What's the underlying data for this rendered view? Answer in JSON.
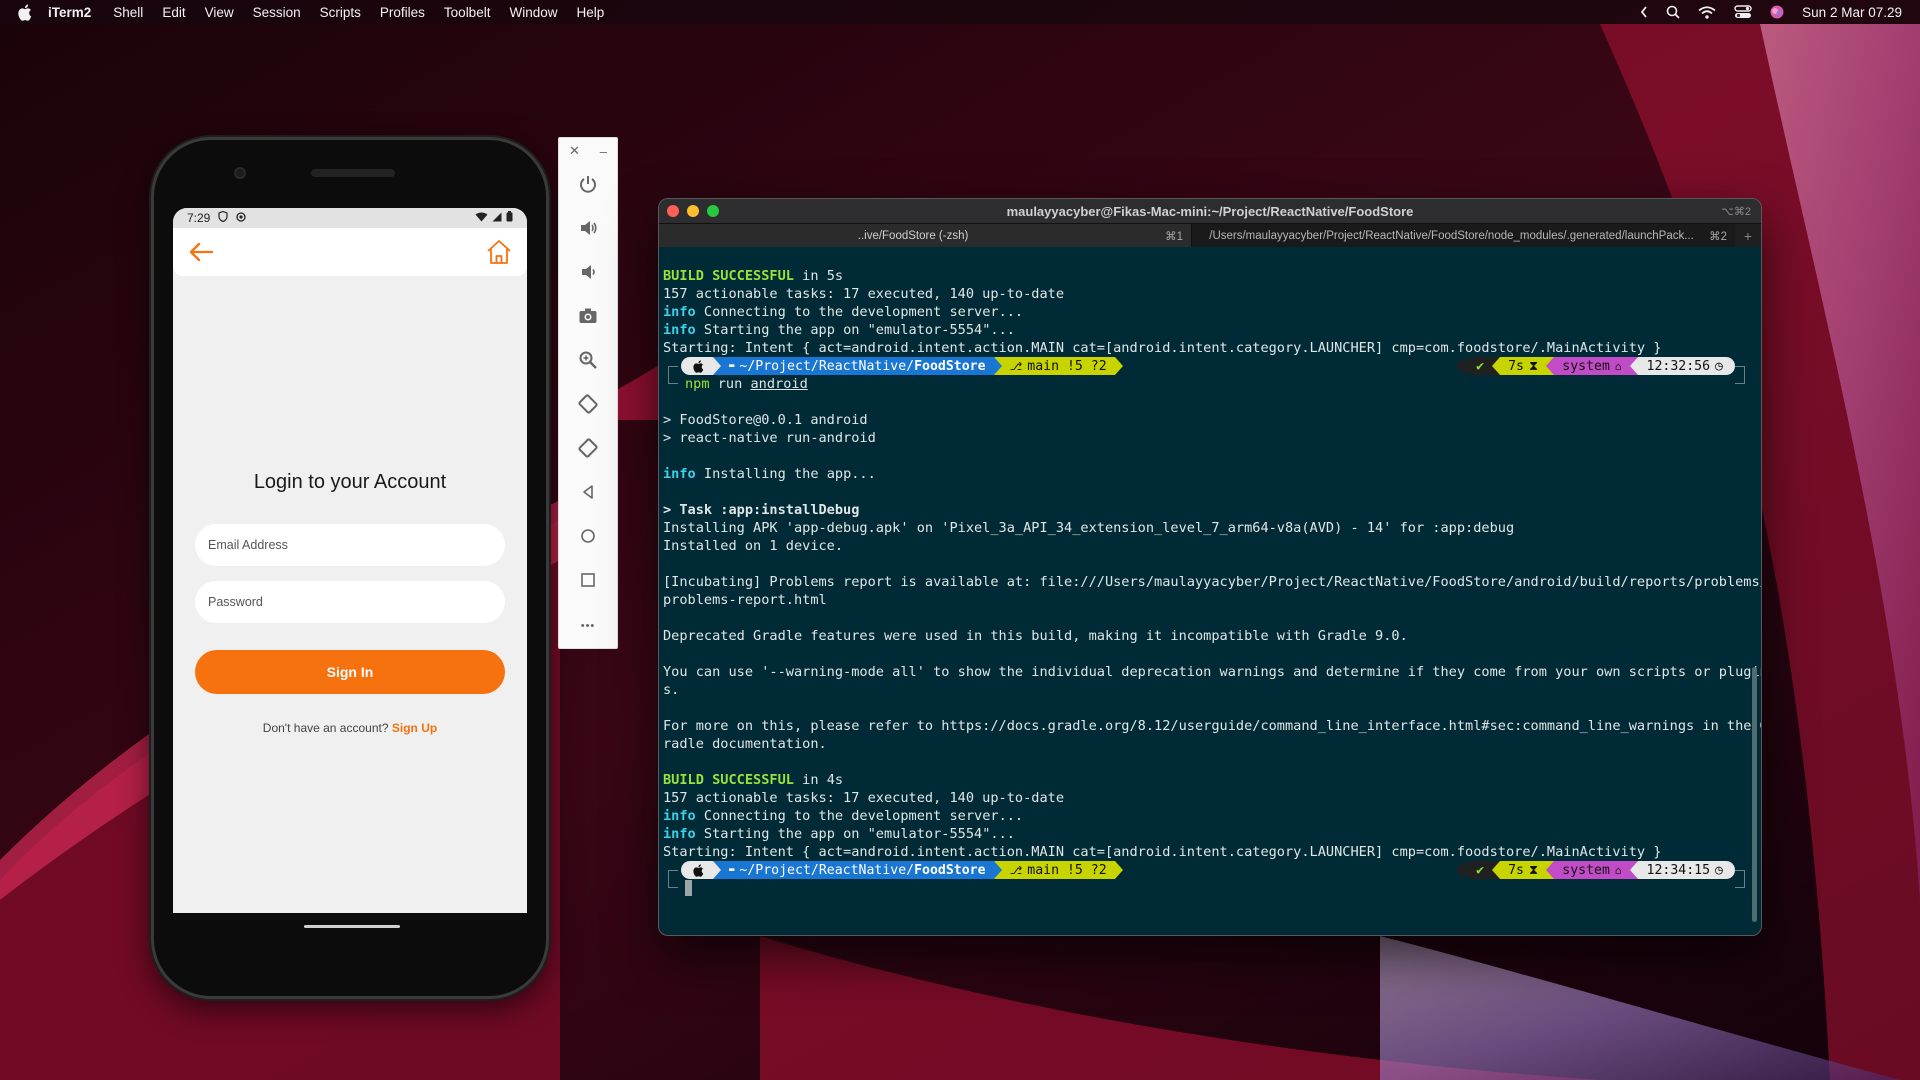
{
  "menubar": {
    "app_name": "iTerm2",
    "menus": [
      "Shell",
      "Edit",
      "View",
      "Session",
      "Scripts",
      "Profiles",
      "Toolbelt",
      "Window",
      "Help"
    ],
    "datetime": "Sun 2 Mar  07.29"
  },
  "phone": {
    "status_time": "7:29",
    "login_title": "Login to your Account",
    "email_placeholder": "Email Address",
    "password_placeholder": "Password",
    "signin_label": "Sign In",
    "signup_prompt": "Don't have an account?",
    "signup_link": "Sign Up",
    "accent_color": "#f5720f"
  },
  "emulator_toolbar": {
    "close_label": "✕",
    "minimize_label": "–",
    "more_label": "•••",
    "buttons": [
      "power-icon",
      "volume-up-icon",
      "volume-down-icon",
      "camera-icon",
      "zoom-icon",
      "rotate-left-icon",
      "rotate-right-icon",
      "back-icon",
      "home-icon",
      "overview-icon",
      "more-icon"
    ]
  },
  "iterm": {
    "title": "maulayyacyber@Fikas-Mac-mini:~/Project/ReactNative/FoodStore",
    "title_shortcut": "⌥⌘2",
    "tabs": [
      {
        "label": "..ive/FoodStore (-zsh)",
        "shortcut": "⌘1"
      },
      {
        "label": "/Users/maulayyacyber/Project/ReactNative/FoodStore/node_modules/.generated/launchPack...",
        "shortcut": "⌘2"
      }
    ],
    "add_tab_label": "+",
    "lines": {
      "l1_a": "BUILD SUCCESSFUL",
      "l1_b": " in 5s",
      "l2": "157 actionable tasks: 17 executed, 140 up-to-date",
      "l3_a": "info",
      "l3_b": " Connecting to the development server...",
      "l4_a": "info",
      "l4_b": " Starting the app on \"emulator-5554\"...",
      "l5": "Starting: Intent { act=android.intent.action.MAIN cat=[android.intent.category.LAUNCHER] cmp=com.foodstore/.MainActivity }",
      "l6": "> FoodStore@0.0.1 android",
      "l7": "> react-native run-android",
      "l8_a": "info",
      "l8_b": " Installing the app...",
      "l9": "> Task :app:installDebug",
      "l10": "Installing APK 'app-debug.apk' on 'Pixel_3a_API_34_extension_level_7_arm64-v8a(AVD) - 14' for :app:debug",
      "l11": "Installed on 1 device.",
      "l12": "[Incubating] Problems report is available at: file:///Users/maulayyacyber/Project/ReactNative/FoodStore/android/build/reports/problems/",
      "l13": "problems-report.html",
      "l14": "Deprecated Gradle features were used in this build, making it incompatible with Gradle 9.0.",
      "l15": "You can use '--warning-mode all' to show the individual deprecation warnings and determine if they come from your own scripts or plugin",
      "l16": "s.",
      "l17": "For more on this, please refer to https://docs.gradle.org/8.12/userguide/command_line_interface.html#sec:command_line_warnings in the G",
      "l18": "radle documentation.",
      "l19_a": "BUILD SUCCESSFUL",
      "l19_b": " in 4s",
      "l20": "157 actionable tasks: 17 executed, 140 up-to-date",
      "l21_a": "info",
      "l21_b": " Connecting to the development server...",
      "l22_a": "info",
      "l22_b": " Starting the app on \"emulator-5554\"...",
      "l23": "Starting: Intent { act=android.intent.action.MAIN cat=[android.intent.category.LAUNCHER] cmp=com.foodstore/.MainActivity }"
    },
    "prompt1": {
      "path_prefix": "~/Project/ReactNative/",
      "path_dir": "FoodStore",
      "git": "main !5 ?2",
      "duration": "7s",
      "env": "system",
      "time": "12:32:56",
      "cmd_a": "npm",
      "cmd_b": " run ",
      "cmd_c": "android"
    },
    "prompt2": {
      "path_prefix": "~/Project/ReactNative/",
      "path_dir": "FoodStore",
      "git": "main !5 ?2",
      "duration": "7s",
      "env": "system",
      "time": "12:34:15"
    }
  }
}
